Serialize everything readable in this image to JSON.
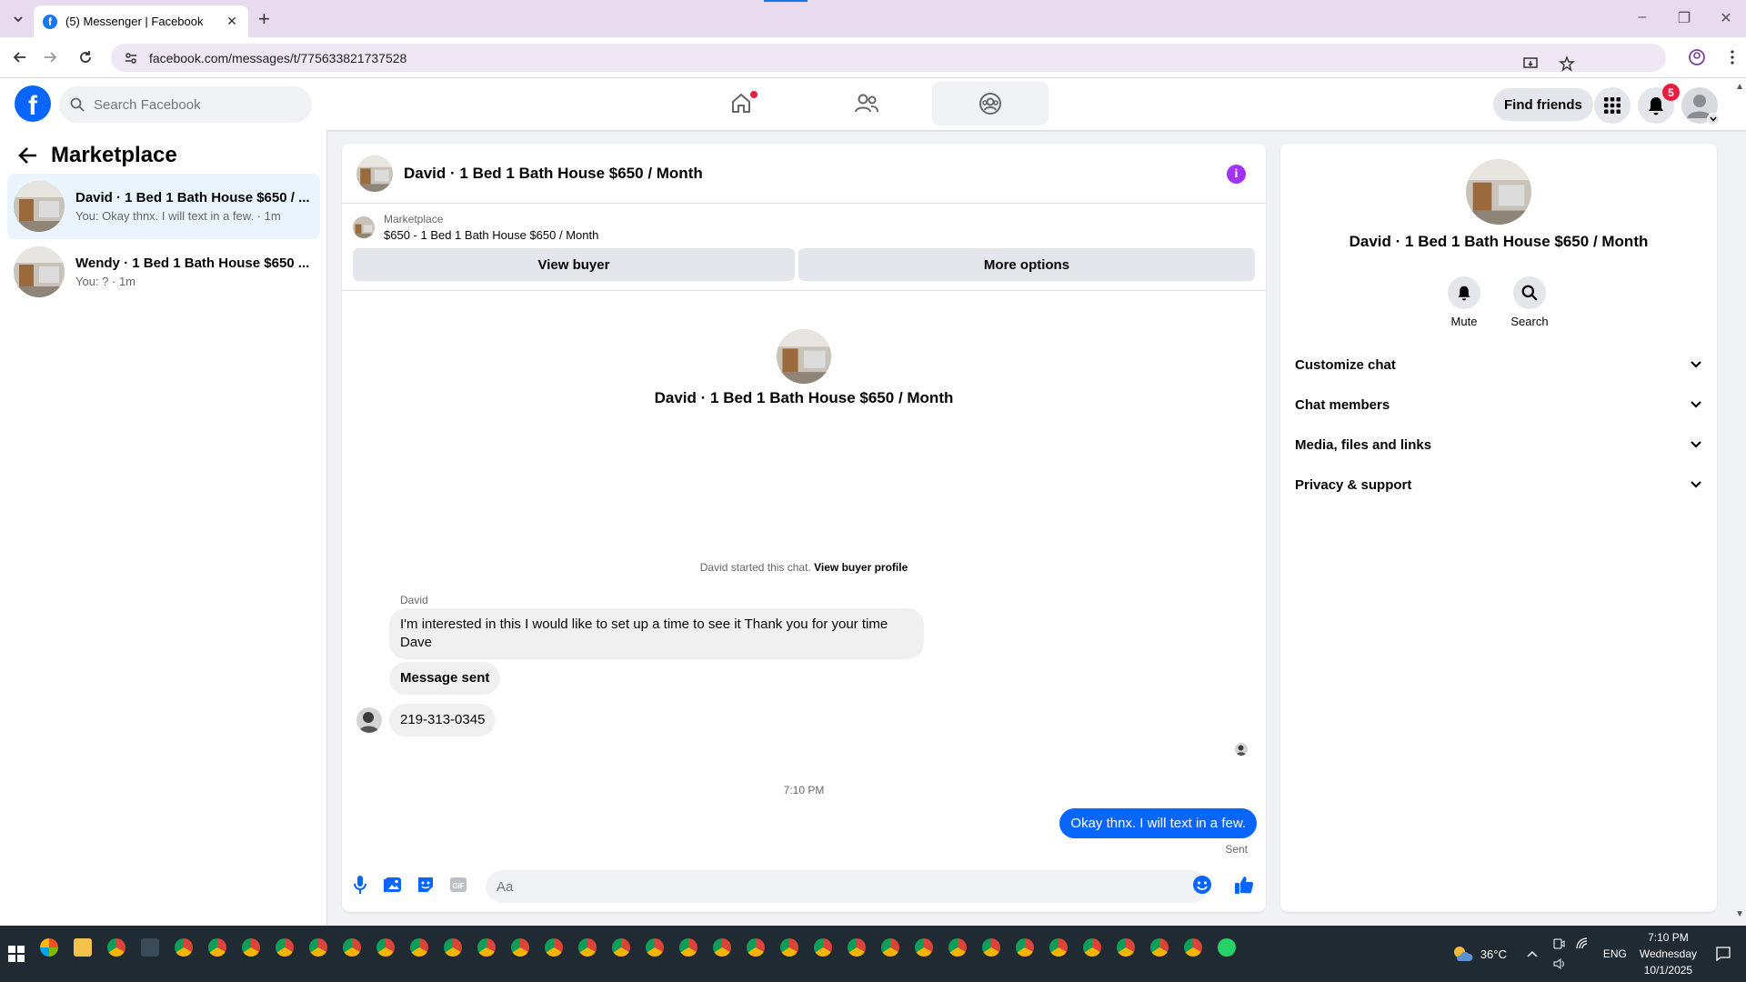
{
  "browser": {
    "tab_title": "(5) Messenger | Facebook",
    "url": "facebook.com/messages/t/775633821737528"
  },
  "header": {
    "search_placeholder": "Search Facebook",
    "find_friends": "Find friends",
    "notification_count": "5",
    "nav": [
      "home-icon",
      "friends-icon",
      "groups-icon"
    ]
  },
  "sidebar": {
    "title": "Marketplace",
    "conversations": [
      {
        "name": "David · 1 Bed 1 Bath House $650 / ...",
        "snippet": "You: Okay thnx. I will text in a few. · 1m"
      },
      {
        "name": "Wendy · 1 Bed 1 Bath House $650 ...",
        "snippet": "You: ? · 1m"
      }
    ]
  },
  "chat": {
    "title": "David · 1 Bed 1 Bath House $650 / Month",
    "marketplace_label": "Marketplace",
    "listing": "$650 - 1 Bed 1 Bath House $650 / Month",
    "view_buyer": "View buyer",
    "more_options": "More options",
    "center_name": "David · 1 Bed 1 Bath House $650 / Month",
    "started_text": "David started this chat.",
    "view_buyer_profile": "View buyer profile",
    "sender": "David",
    "messages_in": [
      "I'm interested in this I would like to set up a time to see it Thank you for your time Dave",
      "Message sent",
      "219-313-0345"
    ],
    "timestamp": "7:10 PM",
    "message_out": "Okay thnx. I will text in a few.",
    "sent_label": "Sent",
    "input_placeholder": "Aa"
  },
  "details": {
    "name": "David · 1 Bed 1 Bath House $650 / Month",
    "mute": "Mute",
    "search": "Search",
    "sections": [
      "Customize chat",
      "Chat members",
      "Media, files and links",
      "Privacy & support"
    ]
  },
  "taskbar": {
    "temperature": "36°C",
    "language": "ENG",
    "time": "7:10 PM",
    "day": "Wednesday",
    "date": "10/1/2025"
  },
  "colors": {
    "fb_blue": "#0866ff",
    "accent_purple": "#a033ff",
    "badge_red": "#e41e3f"
  }
}
